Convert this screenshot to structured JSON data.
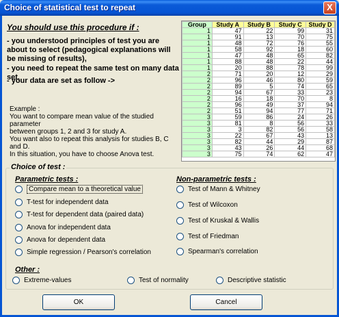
{
  "window": {
    "title": "Choice of statistical test to repeat",
    "close_glyph": "X"
  },
  "intro": {
    "heading": "You should use this procedure if :",
    "bullet1": "- you understood principles of test you are about to select (pedagogical explanations will be missing of results),",
    "bullet2": "- you need to repeat the same test on many data set,",
    "bullet3": "- your data are set as follow ->"
  },
  "example": {
    "l1": "Example :",
    "l2": "You want to compare mean value of the studied parameter",
    "l3": "between groups 1, 2 and 3 for study A.",
    "l4": "You want also to repeat this analysis for studies B, C and D.",
    "l5": "In this situation, you have to choose Anova test."
  },
  "grid": {
    "headers": [
      "Group",
      "Study A",
      "Study B",
      "Study C",
      "Study D"
    ],
    "rows": [
      [
        "1",
        "47",
        "22",
        "99",
        "31"
      ],
      [
        "1",
        "91",
        "13",
        "70",
        "75"
      ],
      [
        "1",
        "48",
        "72",
        "76",
        "55"
      ],
      [
        "1",
        "58",
        "92",
        "18",
        "60"
      ],
      [
        "1",
        "47",
        "48",
        "65",
        "82"
      ],
      [
        "1",
        "88",
        "48",
        "22",
        "44"
      ],
      [
        "1",
        "20",
        "88",
        "78",
        "99"
      ],
      [
        "2",
        "71",
        "20",
        "12",
        "29"
      ],
      [
        "2",
        "96",
        "46",
        "80",
        "59"
      ],
      [
        "2",
        "89",
        "5",
        "74",
        "65"
      ],
      [
        "2",
        "94",
        "67",
        "33",
        "23"
      ],
      [
        "2",
        "16",
        "18",
        "70",
        "8"
      ],
      [
        "2",
        "96",
        "49",
        "37",
        "94"
      ],
      [
        "2",
        "51",
        "94",
        "77",
        "71"
      ],
      [
        "3",
        "59",
        "86",
        "24",
        "26"
      ],
      [
        "3",
        "81",
        "8",
        "56",
        "33"
      ],
      [
        "3",
        "3",
        "82",
        "56",
        "58"
      ],
      [
        "3",
        "22",
        "67",
        "43",
        "13"
      ],
      [
        "3",
        "82",
        "44",
        "29",
        "87"
      ],
      [
        "3",
        "43",
        "26",
        "44",
        "68"
      ],
      [
        "3",
        "75",
        "74",
        "62",
        "47"
      ]
    ]
  },
  "choice": {
    "legend": "Choice of test :",
    "parametric_title": "Parametric tests :",
    "parametric": [
      "Compare mean to a theoretical value",
      "T-test for independent data",
      "T-test for dependent data (paired data)",
      "Anova for independent data",
      "Anova for dependent data",
      "Simple regression / Pearson's correlation"
    ],
    "nonparametric_title": "Non-parametric tests :",
    "nonparametric": [
      "Test of Mann & Whitney",
      "Test of Wilcoxon",
      "Test of Kruskal & Wallis",
      "Test of Friedman",
      "Spearman's correlation"
    ],
    "other_title": "Other :",
    "other": [
      "Extreme-values",
      "Test of normality",
      "Descriptive statistic"
    ]
  },
  "buttons": {
    "ok": "OK",
    "cancel": "Cancel"
  }
}
